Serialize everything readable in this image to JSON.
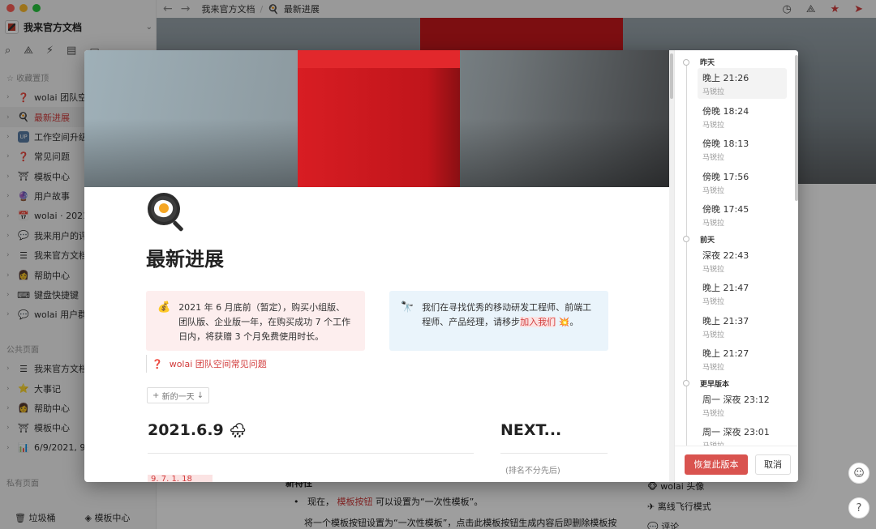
{
  "sidebar": {
    "workspace_name": "我来官方文档",
    "favorites_label": "收藏置顶",
    "public_label": "公共页面",
    "private_label": "私有页面",
    "favorites": [
      {
        "icon": "❓",
        "label": "wolai 团队空间"
      },
      {
        "icon": "🍳",
        "label": "最新进展",
        "active": true
      },
      {
        "icon": "UP",
        "label": "工作空间升级"
      },
      {
        "icon": "❓",
        "label": "常见问题"
      },
      {
        "icon": "⛩",
        "label": "模板中心"
      },
      {
        "icon": "🔮",
        "label": "用户故事"
      },
      {
        "icon": "📅",
        "label": "wolai · 2021"
      },
      {
        "icon": "💬",
        "label": "我来用户的评"
      },
      {
        "icon": "☰",
        "label": "我来官方文档"
      },
      {
        "icon": "👩",
        "label": "帮助中心"
      },
      {
        "icon": "⌨",
        "label": "键盘快捷键"
      },
      {
        "icon": "💬",
        "label": "wolai 用户群"
      }
    ],
    "public_pages": [
      {
        "icon": "☰",
        "label": "我来官方文档"
      },
      {
        "icon": "⭐",
        "label": "大事记"
      },
      {
        "icon": "👩",
        "label": "帮助中心"
      },
      {
        "icon": "⛩",
        "label": "模板中心"
      },
      {
        "icon": "📊",
        "label": "6/9/2021, 9"
      }
    ],
    "footer": {
      "trash": "垃圾桶",
      "templates": "模板中心"
    }
  },
  "topbar": {
    "breadcrumb_root": "我来官方文档",
    "breadcrumb_page": "最新进展"
  },
  "background_page": {
    "bullet_text": "现在，",
    "link_text": "模板按钮",
    "bullet_rest": "可以设置为“一次性模板”。",
    "para_text": "将一个模板按钮设置为“一次性模板”，点击此模板按钮生成内容后即删除模板按",
    "heading_stub": "新特性",
    "right_items": [
      "wolai 头像",
      "离线飞行模式",
      "评论"
    ]
  },
  "preview": {
    "title": "最新进展",
    "callout_left_pre": "2021 年 6 月底前（暂定），购买小组版、团队版、企业版一年，在购买成功 7 个工作日内，将获赠 3 个月免费使用时长。",
    "callout_right_pre": "我们在寻找优秀的移动研发工程师、前端工程师、产品经理，请移步",
    "callout_right_link": "加入我们",
    "callout_right_post": "。",
    "faq_link": "wolai 团队空间常见问题",
    "new_day": "新的一天",
    "heading_date": "2021.6.9",
    "heading_next": "NEXT...",
    "next_note": "(排名不分先后)",
    "date_chip": "9. 7. 1. 18"
  },
  "versions": {
    "groups": [
      {
        "label": "昨天",
        "items": [
          {
            "time": "晚上 21:26",
            "author": "马锐拉",
            "selected": true
          },
          {
            "time": "傍晚 18:24",
            "author": "马锐拉"
          },
          {
            "time": "傍晚 18:13",
            "author": "马锐拉"
          },
          {
            "time": "傍晚 17:56",
            "author": "马锐拉"
          },
          {
            "time": "傍晚 17:45",
            "author": "马锐拉"
          }
        ]
      },
      {
        "label": "前天",
        "items": [
          {
            "time": "深夜 22:43",
            "author": "马锐拉"
          },
          {
            "time": "晚上 21:47",
            "author": "马锐拉"
          },
          {
            "time": "晚上 21:37",
            "author": "马锐拉"
          },
          {
            "time": "晚上 21:27",
            "author": "马锐拉"
          }
        ]
      },
      {
        "label": "更早版本",
        "items": [
          {
            "time": "周一 深夜 23:12",
            "author": "马锐拉"
          },
          {
            "time": "周一 深夜 23:01",
            "author": "马锐拉"
          }
        ]
      }
    ],
    "restore_label": "恢复此版本",
    "cancel_label": "取消"
  },
  "colors": {
    "accent": "#d23b3b",
    "restore_button": "#d9534f",
    "callout_pink": "#fdeeee",
    "callout_blue": "#eaf4fb"
  }
}
